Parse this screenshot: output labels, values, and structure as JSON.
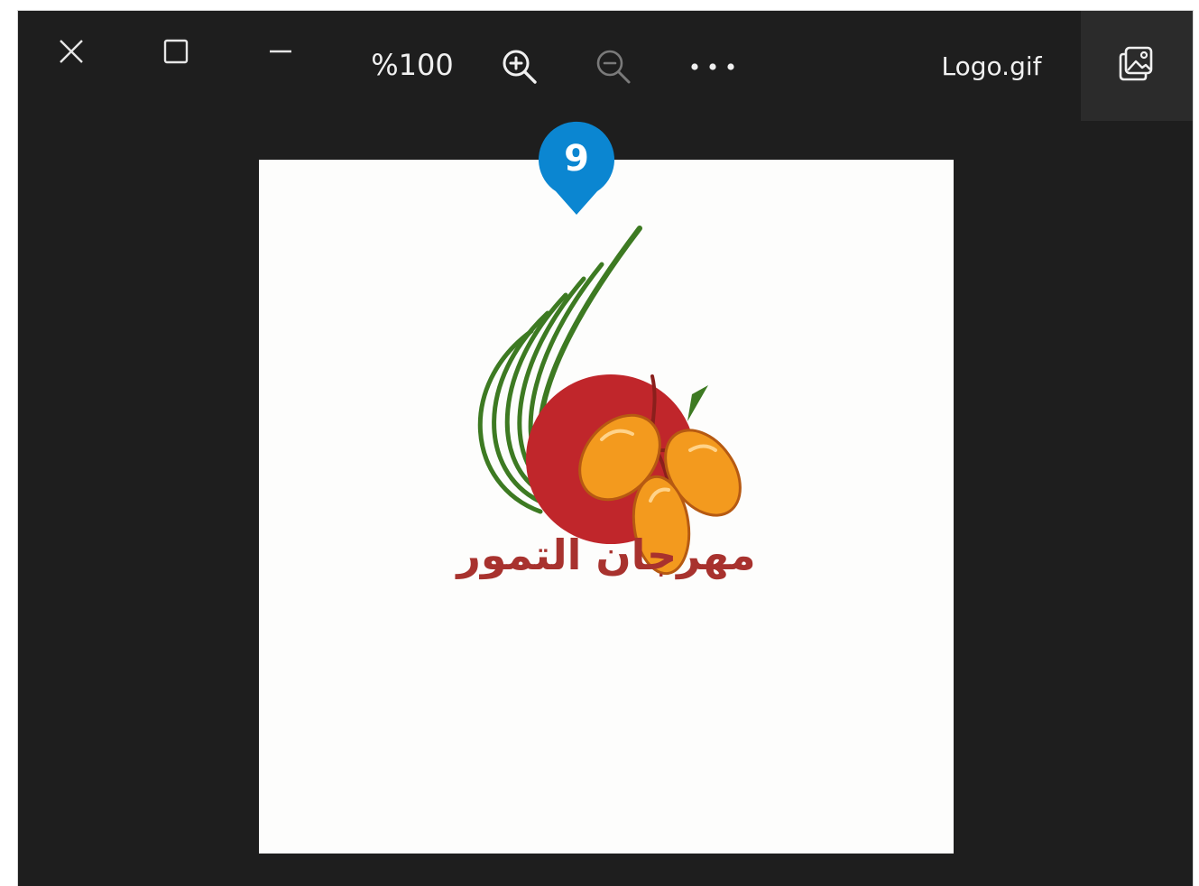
{
  "toolbar": {
    "close_icon": "close-icon",
    "maximize_icon": "maximize-icon",
    "minimize_icon": "minimize-icon",
    "zoom_level": "%100",
    "zoom_in_icon": "zoom-in-icon",
    "zoom_out_icon": "zoom-out-icon",
    "more_icon": "more-options-icon",
    "file_name": "Logo.gif",
    "gallery_icon": "image-gallery-icon"
  },
  "image": {
    "logo_text": "مهرجان التمور"
  },
  "callout": {
    "number": "9",
    "color": "#0b86d1"
  },
  "colors": {
    "background": "#1e1e1e",
    "canvas": "#fdfdfc",
    "logo_red": "#c0262b",
    "logo_green": "#3d7a22",
    "logo_orange": "#f39a1e",
    "text_red": "#a8322e"
  }
}
